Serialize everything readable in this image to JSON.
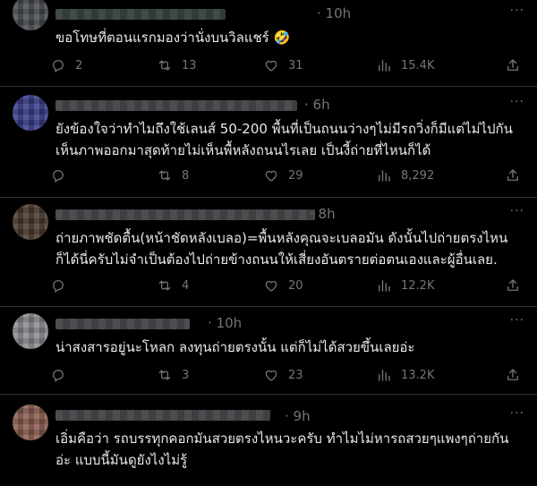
{
  "tweets": [
    {
      "time": "· 10h",
      "text": "ขอโทษที่ตอนแรกมองว่านั่งบนวิลแชร์ 🤣",
      "replies": "2",
      "retweets": "13",
      "likes": "31",
      "views": "15.4K"
    },
    {
      "time": "· 6h",
      "text": "ยังข้องใจว่าทำไมถึงใช้เลนส์ 50-200  พื้นที่เป็นถนนว่างๆไม่มีรถวิ่งก็มีแต่ไม่ไปกัน เห็นภาพออกมาสุดท้ายไม่เห็นพื้หลังถนนไรเลย เป็นงี้ถ่ายที่ไหนก็ได้",
      "replies": "",
      "retweets": "8",
      "likes": "29",
      "views": "8,292"
    },
    {
      "time": "· 8h",
      "text": "ถ่ายภาพชัดตื้น(หน้าชัดหลังเบลอ)=พื้นหลังคุณจะเบลอมัน ดังนั้นไปถ่ายตรงไหนก็ได้นี่ครับไม่จำเป็นต้องไปถ่ายข้างถนนให้เสี่ยงอันตรายต่อตนเองและผู้อื่นเลย.",
      "replies": "",
      "retweets": "4",
      "likes": "20",
      "views": "12.2K"
    },
    {
      "time": "· 10h",
      "text": "น่าสงสารอยู่นะโหลก ลงทุนถ่ายตรงนั้น แต่ก็ไม่ได้สวยขึ้นเลยอ่ะ",
      "replies": "",
      "retweets": "3",
      "likes": "23",
      "views": "13.2K"
    },
    {
      "time": "· 9h",
      "text": "เอิ่มคือว่า รถบรรทุกคอกมันสวยตรงไหนวะครับ ทำไมไม่หารถสวยๆแพงๆถ่ายกันอ่ะ แบบนี้มันดูยังไงไม่รู้",
      "replies": "",
      "retweets": "",
      "likes": "",
      "views": ""
    }
  ],
  "icons": {
    "reply": "reply-icon",
    "retweet": "retweet-icon",
    "like": "heart-icon",
    "views": "views-icon",
    "share": "share-icon",
    "more": "more-icon"
  },
  "colors": {
    "background": "#000000",
    "text": "#e7e9ea",
    "muted": "#71767b",
    "divider": "#2f3336"
  }
}
